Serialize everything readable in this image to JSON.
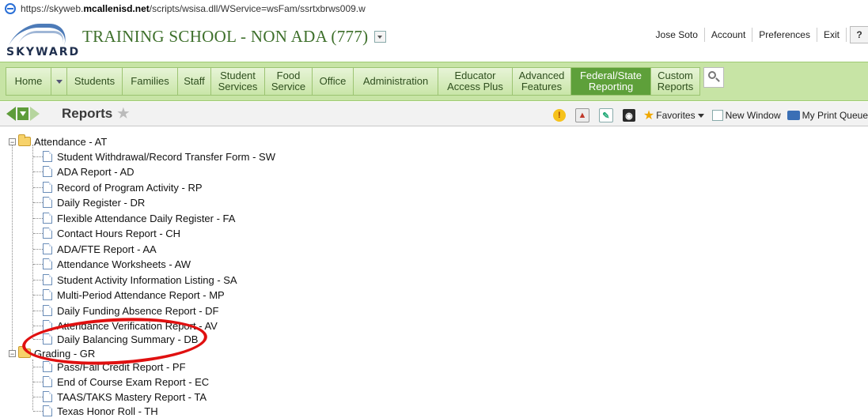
{
  "browser": {
    "url_prefix": "https://skyweb.",
    "url_domain": "mcallenisd.net",
    "url_suffix": "/scripts/wsisa.dll/WService=wsFam/ssrtxbrws009.w"
  },
  "header": {
    "logo_text": "SKYWARD",
    "school_name": "TRAINING SCHOOL - NON ADA (777)",
    "links": [
      "Jose Soto",
      "Account",
      "Preferences",
      "Exit"
    ],
    "help_label": "?"
  },
  "nav": {
    "items": [
      {
        "label": "Home"
      },
      {
        "label": "Students"
      },
      {
        "label": "Families"
      },
      {
        "label": "Staff"
      },
      {
        "label": "Student Services"
      },
      {
        "label": "Food Service"
      },
      {
        "label": "Office"
      },
      {
        "label": "Administration"
      },
      {
        "label": "Educator Access Plus"
      },
      {
        "label": "Advanced Features"
      },
      {
        "label": "Federal/State Reporting"
      },
      {
        "label": "Custom Reports"
      }
    ],
    "active": "Federal/State Reporting"
  },
  "toolbar": {
    "title": "Reports",
    "favorites_label": "Favorites",
    "new_window_label": "New Window",
    "print_queue_label": "My Print Queue"
  },
  "tree": {
    "groups": [
      {
        "label": "Attendance - AT",
        "items": [
          "Student Withdrawal/Record Transfer Form - SW",
          "ADA Report - AD",
          "Record of Program Activity - RP",
          "Daily Register - DR",
          "Flexible Attendance Daily Register - FA",
          "Contact Hours Report - CH",
          "ADA/FTE Report - AA",
          "Attendance Worksheets - AW",
          "Student Activity Information Listing - SA",
          "Multi-Period Attendance Report - MP",
          "Daily Funding Absence Report - DF",
          "Attendance Verification Report - AV",
          "Daily Balancing Summary - DB"
        ]
      },
      {
        "label": "Grading - GR",
        "items": [
          "Pass/Fail Credit Report - PF",
          "End of Course Exam Report - EC",
          "TAAS/TAKS Mastery Report - TA",
          "Texas Honor Roll - TH"
        ]
      }
    ]
  },
  "colors": {
    "nav_bg": "#c7e4a5",
    "nav_active": "#5ea03a",
    "school_text": "#3d6f2a",
    "highlight": "#e01010"
  }
}
